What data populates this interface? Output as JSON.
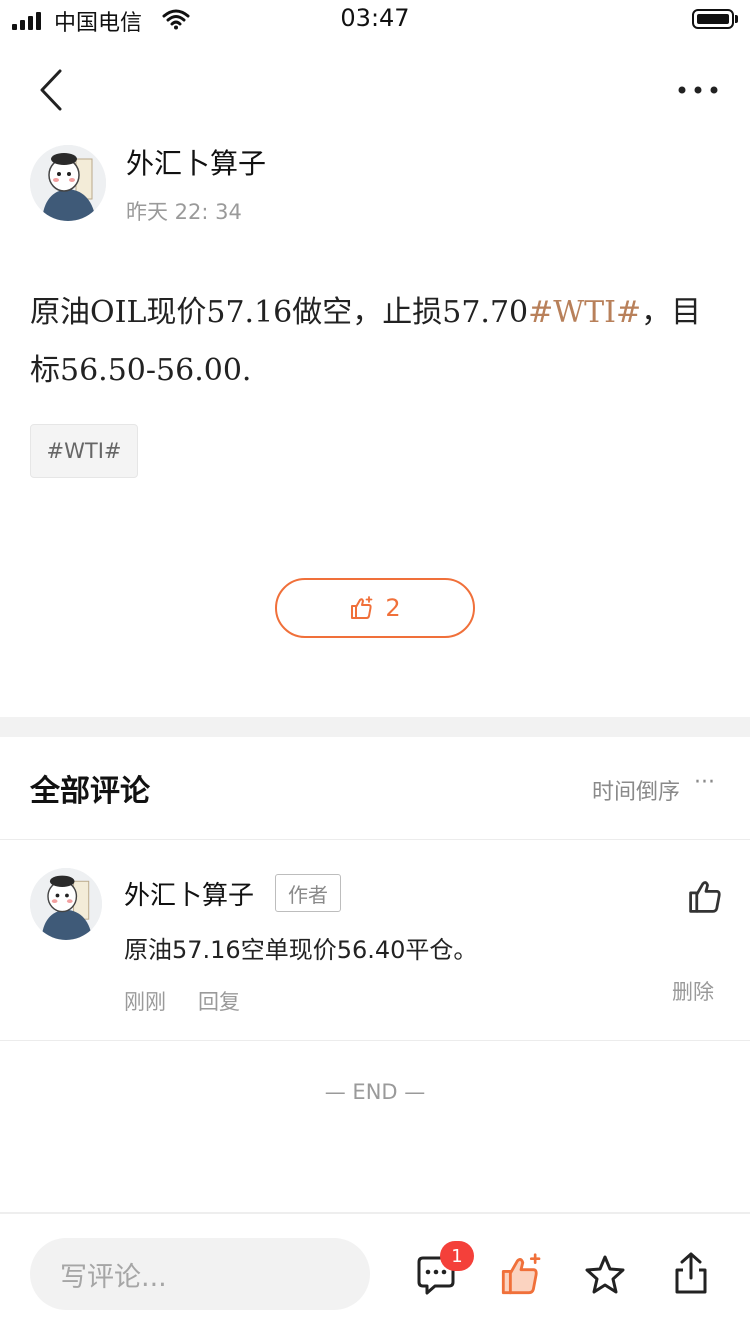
{
  "status_bar": {
    "carrier": "中国电信",
    "time": "03:47"
  },
  "post": {
    "author": "外汇卜算子",
    "time": "昨天 22: 34",
    "body_part1": "原油OIL现价57.16做空，止损57.70",
    "body_hashtag": "#WTI#",
    "body_part2": "，目标56.50-56.00.",
    "tag": "#WTI#",
    "like_count": "2"
  },
  "comments": {
    "title": "全部评论",
    "sort_label": "时间倒序",
    "sort_dots": "···",
    "items": [
      {
        "author": "外汇卜算子",
        "badge": "作者",
        "text": "原油57.16空单现价56.40平仓。",
        "time": "刚刚",
        "reply_label": "回复",
        "delete_label": "删除"
      }
    ],
    "end_marker": "— END —"
  },
  "bottom_bar": {
    "input_placeholder": "写评论...",
    "comment_badge": "1"
  },
  "colors": {
    "accent": "#f0703a",
    "hashtag": "#b8805a",
    "badge_red": "#f4403a"
  },
  "icons": [
    "back-icon",
    "more-icon",
    "thumbs-up-icon",
    "comment-icon",
    "star-icon",
    "share-icon"
  ]
}
